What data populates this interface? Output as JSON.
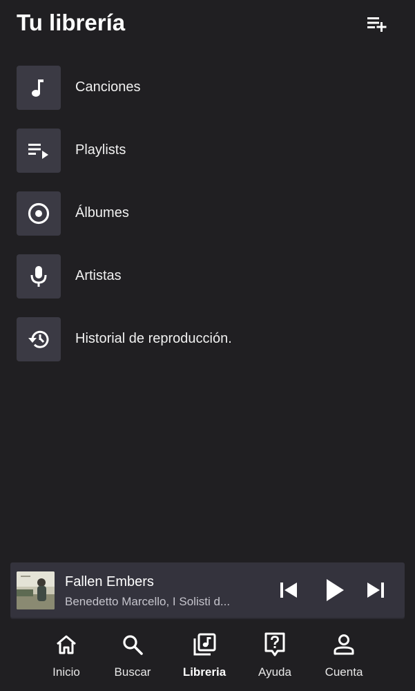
{
  "header": {
    "title": "Tu librería",
    "add_icon": "playlist-add-icon"
  },
  "menu": [
    {
      "label": "Canciones",
      "icon": "music-note-icon"
    },
    {
      "label": "Playlists",
      "icon": "playlist-play-icon"
    },
    {
      "label": "Álbumes",
      "icon": "album-disc-icon"
    },
    {
      "label": "Artistas",
      "icon": "microphone-icon"
    },
    {
      "label": "Historial de reproducción.",
      "icon": "history-icon"
    }
  ],
  "player": {
    "title": "Fallen Embers",
    "artist": "Benedetto Marcello, I Solisti d...",
    "cover_icon": "album-cover-thumbnail"
  },
  "nav": [
    {
      "label": "Inicio",
      "icon": "home-icon",
      "active": false
    },
    {
      "label": "Buscar",
      "icon": "search-icon",
      "active": false
    },
    {
      "label": "Libreria",
      "icon": "library-music-icon",
      "active": true
    },
    {
      "label": "Ayuda",
      "icon": "help-icon",
      "active": false
    },
    {
      "label": "Cuenta",
      "icon": "account-icon",
      "active": false
    }
  ],
  "colors": {
    "background": "#201f22",
    "tile": "#3b3a44",
    "player_bg": "#34333d",
    "text": "#ffffff",
    "muted_text": "#c5c4cc"
  }
}
